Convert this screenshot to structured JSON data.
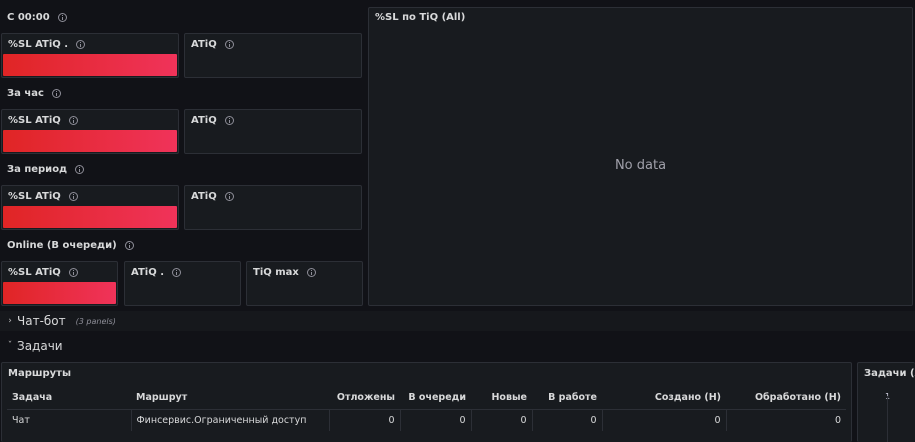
{
  "rows": {
    "r1": "С 00:00",
    "r2": "За час",
    "r3": "За период",
    "r4": "Online (В очереди)"
  },
  "stats": {
    "p1a": "%SL ATiQ .",
    "p1b": "ATiQ",
    "p2a": "%SL ATiQ",
    "p2b": "ATiQ",
    "p3a": "%SL ATiQ",
    "p3b": "ATiQ",
    "p4a": "%SL ATiQ",
    "p4b": "ATiQ .",
    "p4c": "TiQ max"
  },
  "chart": {
    "title": "%SL по TiQ (All)",
    "nodata": "No data"
  },
  "sections": {
    "chatbot": "Чат-бот",
    "chatbot_note": "(3 panels)",
    "tasks": "Задачи"
  },
  "routes": {
    "title": "Маршруты",
    "columns": [
      "Задача",
      "Маршрут",
      "Отложены",
      "В очереди",
      "Новые",
      "В работе",
      "Создано (Н)",
      "Обработано (Н)"
    ],
    "rows": [
      [
        "Чат",
        "Финсервис.Ограниченный доступ",
        "0",
        "0",
        "0",
        "0",
        "0",
        "0"
      ]
    ]
  },
  "tasks_panel": {
    "title": "Задачи (All)",
    "axis_tick": "1"
  }
}
